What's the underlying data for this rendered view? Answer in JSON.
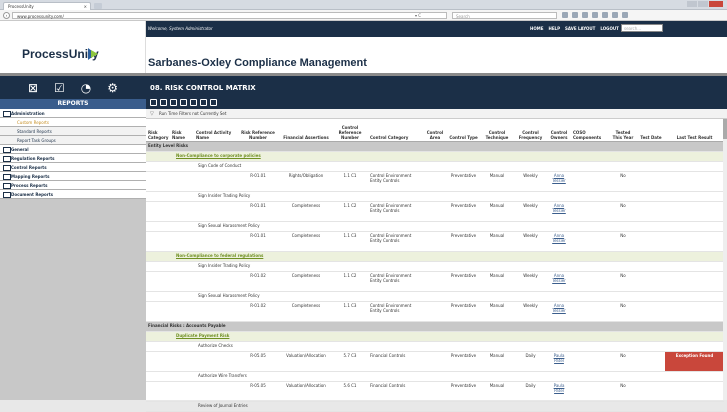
{
  "browser": {
    "tab_title": "ProcessUnity",
    "url": "www.processunity.com/",
    "search_placeholder": "Search"
  },
  "header": {
    "logo": "ProcessUnity",
    "welcome": "Welcome, System Administrator",
    "nav": [
      "HOME",
      "HELP",
      "SAVE LAYOUT",
      "LOGOUT"
    ],
    "search_placeholder": "search...",
    "app_title": "Sarbanes-Oxley Compliance Management"
  },
  "sidebar": {
    "title": "REPORTS",
    "items": [
      {
        "label": "Administration",
        "kind": "folder"
      },
      {
        "label": "Custom Reports",
        "kind": "active"
      },
      {
        "label": "Standard Reports",
        "kind": "sub"
      },
      {
        "label": "Report Task Groups",
        "kind": "sub"
      },
      {
        "label": "General",
        "kind": "folder"
      },
      {
        "label": "Regulation Reports",
        "kind": "folder"
      },
      {
        "label": "Control Reports",
        "kind": "folder"
      },
      {
        "label": "Mapping Reports",
        "kind": "folder"
      },
      {
        "label": "Process Reports",
        "kind": "folder"
      },
      {
        "label": "Document Reports",
        "kind": "folder"
      }
    ]
  },
  "main": {
    "title": "08. RISK CONTROL MATRIX",
    "filter_text": "Run Time Filters not Currently Set",
    "columns": [
      "Risk Category",
      "Risk Name",
      "Control Activity Name",
      "Risk Reference Number",
      "Financial Assertions",
      "Control Reference Number",
      "Control Category",
      "Control Area",
      "Control Type",
      "Control Technique",
      "Control Frequency",
      "Control Owners",
      "COSO Components",
      "Tested This Year",
      "Test Date",
      "Last Test Result"
    ],
    "rows": [
      {
        "kind": "group",
        "text": "Entity Level Risks"
      },
      {
        "kind": "sub",
        "text": "Non-Compliance to corporate policies"
      },
      {
        "kind": "item",
        "text": "Sign Code of Conduct"
      },
      {
        "kind": "data",
        "cells": [
          "",
          "",
          "",
          "R-01.01",
          "Rights/Obligation",
          "1.1 C1",
          "Control Environment Entity Controls",
          "",
          "Preventative",
          "Manual",
          "Weekly",
          "Anna Tessier",
          "",
          "No",
          "",
          ""
        ]
      },
      {
        "kind": "item",
        "text": "Sign Insider Trading Policy"
      },
      {
        "kind": "data",
        "cells": [
          "",
          "",
          "",
          "R-01.01",
          "Completeness",
          "1.1 C2",
          "Control Environment Entity Controls",
          "",
          "Preventative",
          "Manual",
          "Weekly",
          "Anna Tessier",
          "",
          "No",
          "",
          ""
        ]
      },
      {
        "kind": "item",
        "text": "Sign Sexual Harassment Policy"
      },
      {
        "kind": "data",
        "cells": [
          "",
          "",
          "",
          "R-01.01",
          "Completeness",
          "1.1 C3",
          "Control Environment Entity Controls",
          "",
          "Preventative",
          "Manual",
          "Weekly",
          "Anna Tessier",
          "",
          "No",
          "",
          ""
        ]
      },
      {
        "kind": "sub",
        "text": "Non-Compliance to federal regulations"
      },
      {
        "kind": "item",
        "text": "Sign Insider Trading Policy"
      },
      {
        "kind": "data",
        "cells": [
          "",
          "",
          "",
          "R-01.02",
          "Completeness",
          "1.1 C2",
          "Control Environment Entity Controls",
          "",
          "Preventative",
          "Manual",
          "Weekly",
          "Anna Tessier",
          "",
          "No",
          "",
          ""
        ]
      },
      {
        "kind": "item",
        "text": "Sign Sexual Harassment Policy"
      },
      {
        "kind": "data",
        "cells": [
          "",
          "",
          "",
          "R-01.02",
          "Completeness",
          "1.1 C3",
          "Control Environment Entity Controls",
          "",
          "Preventative",
          "Manual",
          "Weekly",
          "Anna Tessier",
          "",
          "No",
          "",
          ""
        ]
      },
      {
        "kind": "group",
        "text": "Financial Risks : Accounts Payable"
      },
      {
        "kind": "sub",
        "text": "Duplicate Payment Risk"
      },
      {
        "kind": "item",
        "text": "Authorize Checks"
      },
      {
        "kind": "data",
        "cells": [
          "",
          "",
          "",
          "R-05.05",
          "Valuation/Allocation",
          "5.7 C3",
          "Financial Controls",
          "",
          "Preventative",
          "Manual",
          "Daily",
          "Paula Patel",
          "",
          "No",
          "",
          "Exception Found"
        ]
      },
      {
        "kind": "item",
        "text": "Authorize Wire Transfers"
      },
      {
        "kind": "data",
        "cells": [
          "",
          "",
          "",
          "R-05.05",
          "Valuation/Allocation",
          "5.6 C1",
          "Financial Controls",
          "",
          "Preventative",
          "Manual",
          "Daily",
          "Paula Patel",
          "",
          "No",
          "",
          ""
        ]
      },
      {
        "kind": "item",
        "text": "Review of Journal Entries"
      }
    ]
  }
}
